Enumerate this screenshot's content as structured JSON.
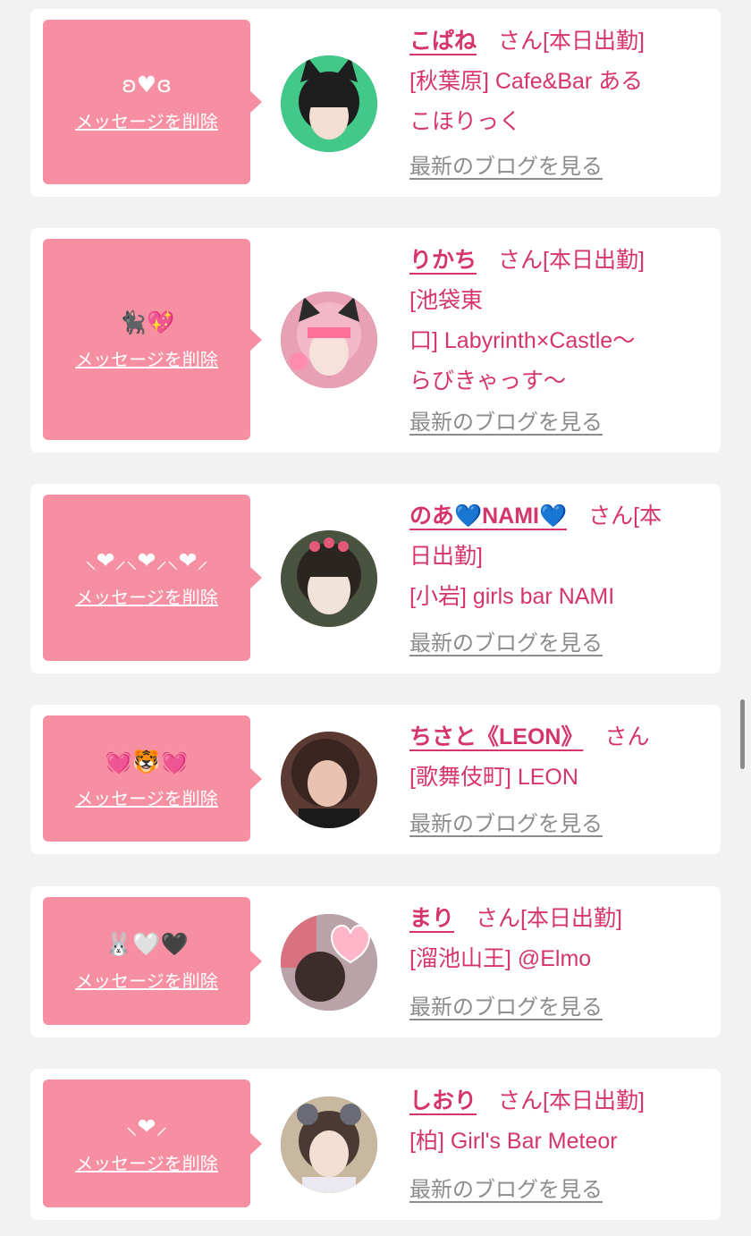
{
  "common": {
    "delete_label": "メッセージを削除",
    "blog_label": "最新のブログを見る",
    "san_suffix": "さん"
  },
  "entries": [
    {
      "message": "ʚ♥ɞ",
      "name": "こぱね",
      "after": "[本日出勤]",
      "shop_line1": "[秋葉原] Cafe&Bar ある",
      "shop_line2": "こほりっく",
      "shop_line3": "",
      "avatar_bg": "#42c98a"
    },
    {
      "message": "🐈‍⬛💖",
      "name": "りかち",
      "after": "[本日出勤]",
      "shop_line1": "[池袋東",
      "shop_line2": "口] Labyrinth×Castle〜",
      "shop_line3": "らびきゃっす〜",
      "avatar_bg": "#e8a0b4"
    },
    {
      "message": "⸜❤︎⸝‍⸜❤︎⸝‍⸜❤︎⸝‍",
      "name": "のあ💙NAMI💙",
      "after": "[本",
      "shop_line1": "日出勤]",
      "shop_line2": "[小岩] girls bar NAMI",
      "shop_line3": "",
      "avatar_bg": "#4a5240"
    },
    {
      "message": "💓🐯💓",
      "name": "ちさと《LEON》",
      "after": "",
      "shop_line1": "[歌舞伎町] LEON",
      "shop_line2": "",
      "shop_line3": "",
      "avatar_bg": "#5a3a33"
    },
    {
      "message": "🐰🤍🖤",
      "name": "まり",
      "after": "[本日出勤]",
      "shop_line1": "[溜池山王] @Elmo",
      "shop_line2": "",
      "shop_line3": "",
      "avatar_bg": "#b9a3a8"
    },
    {
      "message": "⸜❤︎⸝‍",
      "name": "しおり",
      "after": "[本日出勤]",
      "shop_line1": "[柏] Girl's Bar Meteor",
      "shop_line2": "",
      "shop_line3": "",
      "avatar_bg": "#c8b8a0"
    }
  ]
}
